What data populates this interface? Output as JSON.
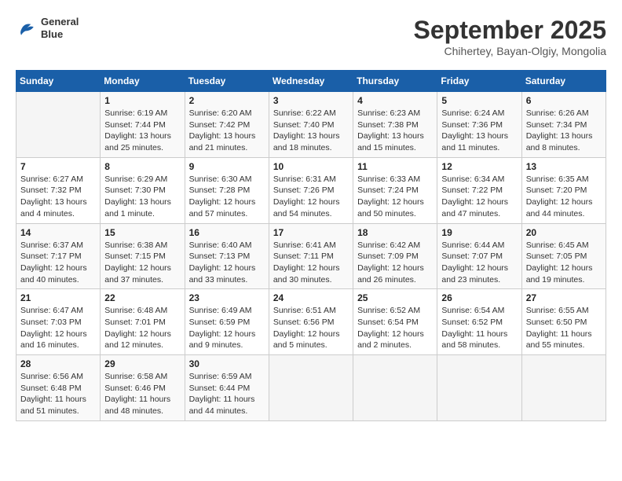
{
  "header": {
    "logo_line1": "General",
    "logo_line2": "Blue",
    "month_year": "September 2025",
    "subtitle": "Chihertey, Bayan-Olgiy, Mongolia"
  },
  "weekdays": [
    "Sunday",
    "Monday",
    "Tuesday",
    "Wednesday",
    "Thursday",
    "Friday",
    "Saturday"
  ],
  "weeks": [
    [
      {
        "day": "",
        "info": ""
      },
      {
        "day": "1",
        "info": "Sunrise: 6:19 AM\nSunset: 7:44 PM\nDaylight: 13 hours\nand 25 minutes."
      },
      {
        "day": "2",
        "info": "Sunrise: 6:20 AM\nSunset: 7:42 PM\nDaylight: 13 hours\nand 21 minutes."
      },
      {
        "day": "3",
        "info": "Sunrise: 6:22 AM\nSunset: 7:40 PM\nDaylight: 13 hours\nand 18 minutes."
      },
      {
        "day": "4",
        "info": "Sunrise: 6:23 AM\nSunset: 7:38 PM\nDaylight: 13 hours\nand 15 minutes."
      },
      {
        "day": "5",
        "info": "Sunrise: 6:24 AM\nSunset: 7:36 PM\nDaylight: 13 hours\nand 11 minutes."
      },
      {
        "day": "6",
        "info": "Sunrise: 6:26 AM\nSunset: 7:34 PM\nDaylight: 13 hours\nand 8 minutes."
      }
    ],
    [
      {
        "day": "7",
        "info": "Sunrise: 6:27 AM\nSunset: 7:32 PM\nDaylight: 13 hours\nand 4 minutes."
      },
      {
        "day": "8",
        "info": "Sunrise: 6:29 AM\nSunset: 7:30 PM\nDaylight: 13 hours\nand 1 minute."
      },
      {
        "day": "9",
        "info": "Sunrise: 6:30 AM\nSunset: 7:28 PM\nDaylight: 12 hours\nand 57 minutes."
      },
      {
        "day": "10",
        "info": "Sunrise: 6:31 AM\nSunset: 7:26 PM\nDaylight: 12 hours\nand 54 minutes."
      },
      {
        "day": "11",
        "info": "Sunrise: 6:33 AM\nSunset: 7:24 PM\nDaylight: 12 hours\nand 50 minutes."
      },
      {
        "day": "12",
        "info": "Sunrise: 6:34 AM\nSunset: 7:22 PM\nDaylight: 12 hours\nand 47 minutes."
      },
      {
        "day": "13",
        "info": "Sunrise: 6:35 AM\nSunset: 7:20 PM\nDaylight: 12 hours\nand 44 minutes."
      }
    ],
    [
      {
        "day": "14",
        "info": "Sunrise: 6:37 AM\nSunset: 7:17 PM\nDaylight: 12 hours\nand 40 minutes."
      },
      {
        "day": "15",
        "info": "Sunrise: 6:38 AM\nSunset: 7:15 PM\nDaylight: 12 hours\nand 37 minutes."
      },
      {
        "day": "16",
        "info": "Sunrise: 6:40 AM\nSunset: 7:13 PM\nDaylight: 12 hours\nand 33 minutes."
      },
      {
        "day": "17",
        "info": "Sunrise: 6:41 AM\nSunset: 7:11 PM\nDaylight: 12 hours\nand 30 minutes."
      },
      {
        "day": "18",
        "info": "Sunrise: 6:42 AM\nSunset: 7:09 PM\nDaylight: 12 hours\nand 26 minutes."
      },
      {
        "day": "19",
        "info": "Sunrise: 6:44 AM\nSunset: 7:07 PM\nDaylight: 12 hours\nand 23 minutes."
      },
      {
        "day": "20",
        "info": "Sunrise: 6:45 AM\nSunset: 7:05 PM\nDaylight: 12 hours\nand 19 minutes."
      }
    ],
    [
      {
        "day": "21",
        "info": "Sunrise: 6:47 AM\nSunset: 7:03 PM\nDaylight: 12 hours\nand 16 minutes."
      },
      {
        "day": "22",
        "info": "Sunrise: 6:48 AM\nSunset: 7:01 PM\nDaylight: 12 hours\nand 12 minutes."
      },
      {
        "day": "23",
        "info": "Sunrise: 6:49 AM\nSunset: 6:59 PM\nDaylight: 12 hours\nand 9 minutes."
      },
      {
        "day": "24",
        "info": "Sunrise: 6:51 AM\nSunset: 6:56 PM\nDaylight: 12 hours\nand 5 minutes."
      },
      {
        "day": "25",
        "info": "Sunrise: 6:52 AM\nSunset: 6:54 PM\nDaylight: 12 hours\nand 2 minutes."
      },
      {
        "day": "26",
        "info": "Sunrise: 6:54 AM\nSunset: 6:52 PM\nDaylight: 11 hours\nand 58 minutes."
      },
      {
        "day": "27",
        "info": "Sunrise: 6:55 AM\nSunset: 6:50 PM\nDaylight: 11 hours\nand 55 minutes."
      }
    ],
    [
      {
        "day": "28",
        "info": "Sunrise: 6:56 AM\nSunset: 6:48 PM\nDaylight: 11 hours\nand 51 minutes."
      },
      {
        "day": "29",
        "info": "Sunrise: 6:58 AM\nSunset: 6:46 PM\nDaylight: 11 hours\nand 48 minutes."
      },
      {
        "day": "30",
        "info": "Sunrise: 6:59 AM\nSunset: 6:44 PM\nDaylight: 11 hours\nand 44 minutes."
      },
      {
        "day": "",
        "info": ""
      },
      {
        "day": "",
        "info": ""
      },
      {
        "day": "",
        "info": ""
      },
      {
        "day": "",
        "info": ""
      }
    ]
  ]
}
